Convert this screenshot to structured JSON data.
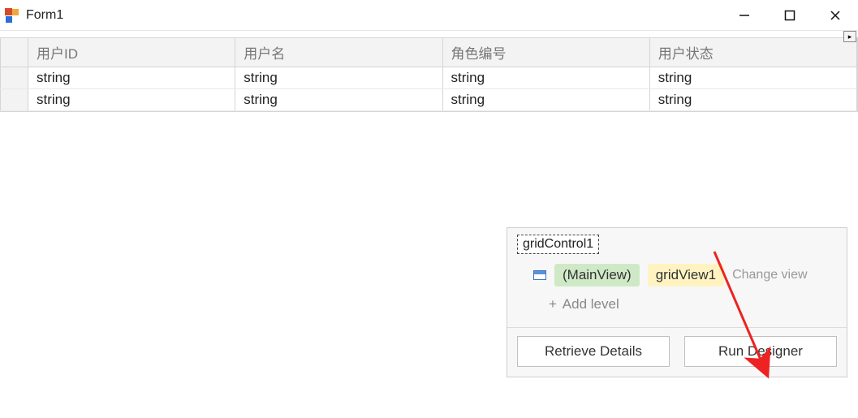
{
  "window": {
    "title": "Form1"
  },
  "grid": {
    "columns": [
      "用户ID",
      "用户名",
      "角色编号",
      "用户状态"
    ],
    "rows": [
      [
        "string",
        "string",
        "string",
        "string"
      ],
      [
        "string",
        "string",
        "string",
        "string"
      ]
    ]
  },
  "designer": {
    "control_name": "gridControl1",
    "main_view_label": "(MainView)",
    "view_name": "gridView1",
    "change_view_label": "Change view",
    "add_level_label": "Add level",
    "retrieve_button": "Retrieve Details",
    "run_designer_button": "Run Designer"
  }
}
